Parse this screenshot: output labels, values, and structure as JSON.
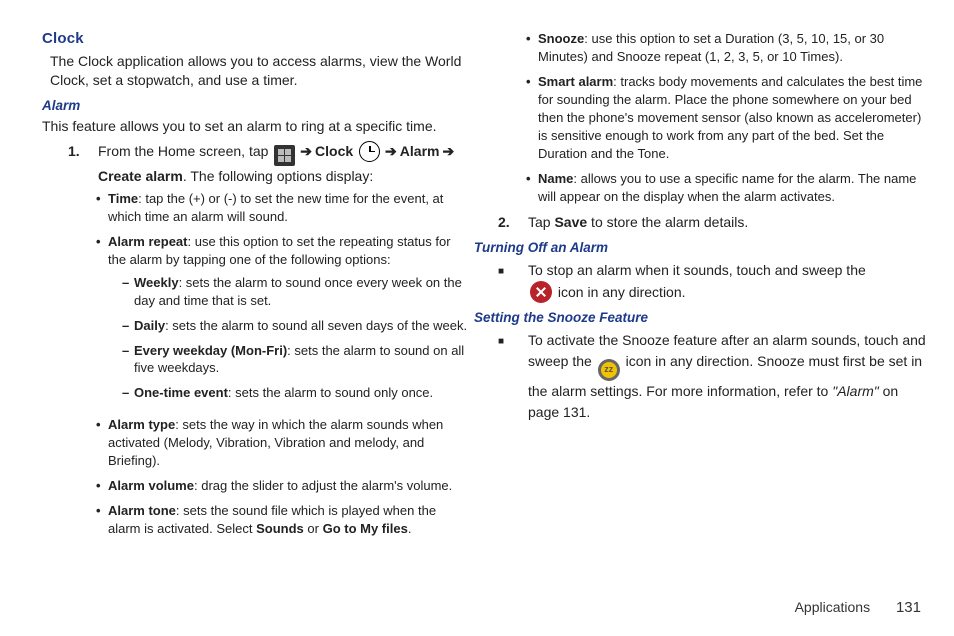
{
  "left": {
    "h1": "Clock",
    "intro": "The Clock application allows you to access alarms, view the World Clock, set a stopwatch, and use a timer.",
    "h2": "Alarm",
    "intro2": "This feature allows you to set an alarm to ring at a specific time.",
    "step1_num": "1.",
    "step1_a": "From the Home screen, tap ",
    "step1_b": "Clock",
    "step1_c": "Alarm",
    "step1_d": "Create alarm",
    "step1_e": ". The following options display:",
    "bullets": [
      {
        "label": "Time",
        "text": ": tap the (+) or (-) to set the new time for the event, at which time an alarm will sound."
      },
      {
        "label": "Alarm repeat",
        "text": ": use this option to set the repeating status for the alarm by tapping one of the following options:",
        "sub": [
          {
            "label": "Weekly",
            "text": ": sets the alarm to sound once every week on the day and time that is set."
          },
          {
            "label": "Daily",
            "text": ": sets the alarm to sound all seven days of the week."
          },
          {
            "label": "Every weekday (Mon-Fri)",
            "text": ": sets the alarm to sound on all five weekdays."
          },
          {
            "label": "One-time event",
            "text": ": sets the alarm to sound only once."
          }
        ]
      },
      {
        "label": "Alarm type",
        "text": ": sets the way in which the alarm sounds when activated (Melody, Vibration, Vibration and melody, and Briefing)."
      },
      {
        "label": "Alarm volume",
        "text": ": drag the slider to adjust the alarm's volume."
      },
      {
        "label": "Alarm tone",
        "text_a": ": sets the sound file which is played when the alarm is activated. Select ",
        "text_b": "Sounds",
        "text_c": " or ",
        "text_d": "Go to My files",
        "text_e": "."
      }
    ]
  },
  "right": {
    "top_bullets": [
      {
        "label": "Snooze",
        "text": ": use this option to set a Duration (3, 5, 10, 15, or 30 Minutes) and Snooze repeat (1, 2, 3, 5, or 10 Times)."
      },
      {
        "label": "Smart alarm",
        "text": ": tracks body movements and calculates the best time for sounding the alarm. Place the phone somewhere on your bed then the phone's movement sensor (also known as accelerometer) is sensitive enough to work from any part of the bed. Set the Duration and the Tone."
      },
      {
        "label": "Name",
        "text": ": allows you to use a specific name for the alarm. The name will appear on the display when the alarm activates."
      }
    ],
    "step2_num": "2.",
    "step2_a": "Tap ",
    "step2_b": "Save",
    "step2_c": " to store the alarm details.",
    "h2a": "Turning Off an Alarm",
    "off_a": "To stop an alarm when it sounds, touch and sweep the ",
    "off_b": " icon in any direction.",
    "h2b": "Setting the Snooze Feature",
    "sn_a": "To activate the Snooze feature after an alarm sounds, touch and sweep the ",
    "sn_b": " icon in any direction. Snooze must first be set in the alarm settings. For more information, refer to ",
    "sn_ref": "\"Alarm\"",
    "sn_c": " on page 131."
  },
  "footer": {
    "section": "Applications",
    "page": "131"
  }
}
